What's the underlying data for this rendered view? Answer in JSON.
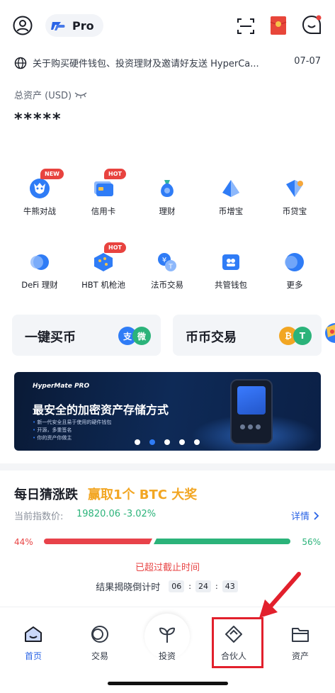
{
  "header": {
    "pro_label": "Pro"
  },
  "announcement": {
    "text": "关于购买硬件钱包、投资理财及邀请好友送 HyperCa...",
    "date": "07-07"
  },
  "assets": {
    "label": "总资产 (USD)",
    "value": "*****"
  },
  "grid": [
    {
      "label": "牛熊对战",
      "badge": "NEW",
      "icon": "bull-bear-icon"
    },
    {
      "label": "信用卡",
      "badge": "HOT",
      "icon": "credit-card-icon"
    },
    {
      "label": "理财",
      "badge": "",
      "icon": "money-bag-icon"
    },
    {
      "label": "币增宝",
      "badge": "",
      "icon": "coin-growth-icon"
    },
    {
      "label": "币贷宝",
      "badge": "",
      "icon": "coin-loan-icon"
    },
    {
      "label": "DeFi 理财",
      "badge": "",
      "icon": "defi-icon"
    },
    {
      "label": "HBT 机枪池",
      "badge": "HOT",
      "icon": "pool-icon"
    },
    {
      "label": "法币交易",
      "badge": "",
      "icon": "fiat-trade-icon"
    },
    {
      "label": "共管钱包",
      "badge": "",
      "icon": "shared-wallet-icon"
    },
    {
      "label": "更多",
      "badge": "",
      "icon": "more-icon"
    }
  ],
  "quick": {
    "buy_label": "一键买币",
    "trade_label": "币币交易",
    "buy_icon_1": "支",
    "buy_icon_2": "微",
    "trade_icon_1": "₿",
    "trade_icon_2": "T"
  },
  "banner": {
    "brand": "HyperMate PRO",
    "title": "最安全的加密资产存储方式",
    "bullets": [
      "新一代安全且易于使用的硬件钱包",
      "开源，多重签名",
      "你的资产你做主"
    ],
    "slides": 5,
    "active_slide": 2
  },
  "guess": {
    "title": "每日猜涨跌",
    "prize": "赢取1个 BTC 大奖",
    "index_label": "当前指数价:",
    "index_value": "19820.06 -3.02%",
    "details_label": "详情",
    "left_pct": "44%",
    "right_pct": "56%",
    "left_ratio": 0.44,
    "deadline": "已超过截止时间",
    "countdown_label": "结果揭晓倒计时",
    "countdown": [
      "06",
      "24",
      "43"
    ]
  },
  "nav": [
    {
      "label": "首页",
      "active": true
    },
    {
      "label": "交易",
      "active": false
    },
    {
      "label": "投资",
      "active": false
    },
    {
      "label": "合伙人",
      "active": false
    },
    {
      "label": "资产",
      "active": false
    }
  ],
  "colors": {
    "accent": "#2a64e6",
    "up": "#2bb37a",
    "down": "#e8424a",
    "prize": "#f2a623",
    "annotation": "#e2202c"
  }
}
